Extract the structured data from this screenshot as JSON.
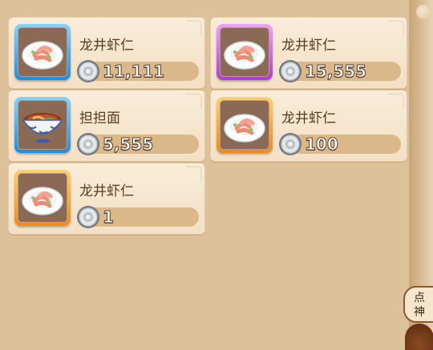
{
  "items": [
    {
      "name": "龙井虾仁",
      "price": "11,111",
      "frame": "blue",
      "icon": "shrimp-dish-icon"
    },
    {
      "name": "龙井虾仁",
      "price": "15,555",
      "frame": "purple",
      "icon": "shrimp-dish-icon"
    },
    {
      "name": "担担面",
      "price": "5,555",
      "frame": "blue",
      "icon": "noodle-bowl-icon"
    },
    {
      "name": "龙井虾仁",
      "price": "100",
      "frame": "orange",
      "icon": "shrimp-dish-icon"
    },
    {
      "name": "龙井虾仁",
      "price": "1",
      "frame": "orange",
      "icon": "shrimp-dish-icon"
    }
  ],
  "currency_icon": "silver-coin-icon",
  "side_hint": {
    "line1": "点",
    "line2": "神"
  },
  "colors": {
    "blue_frame": "#1e8ee0",
    "purple_frame": "#b03ad6",
    "orange_frame": "#f08a1a"
  }
}
